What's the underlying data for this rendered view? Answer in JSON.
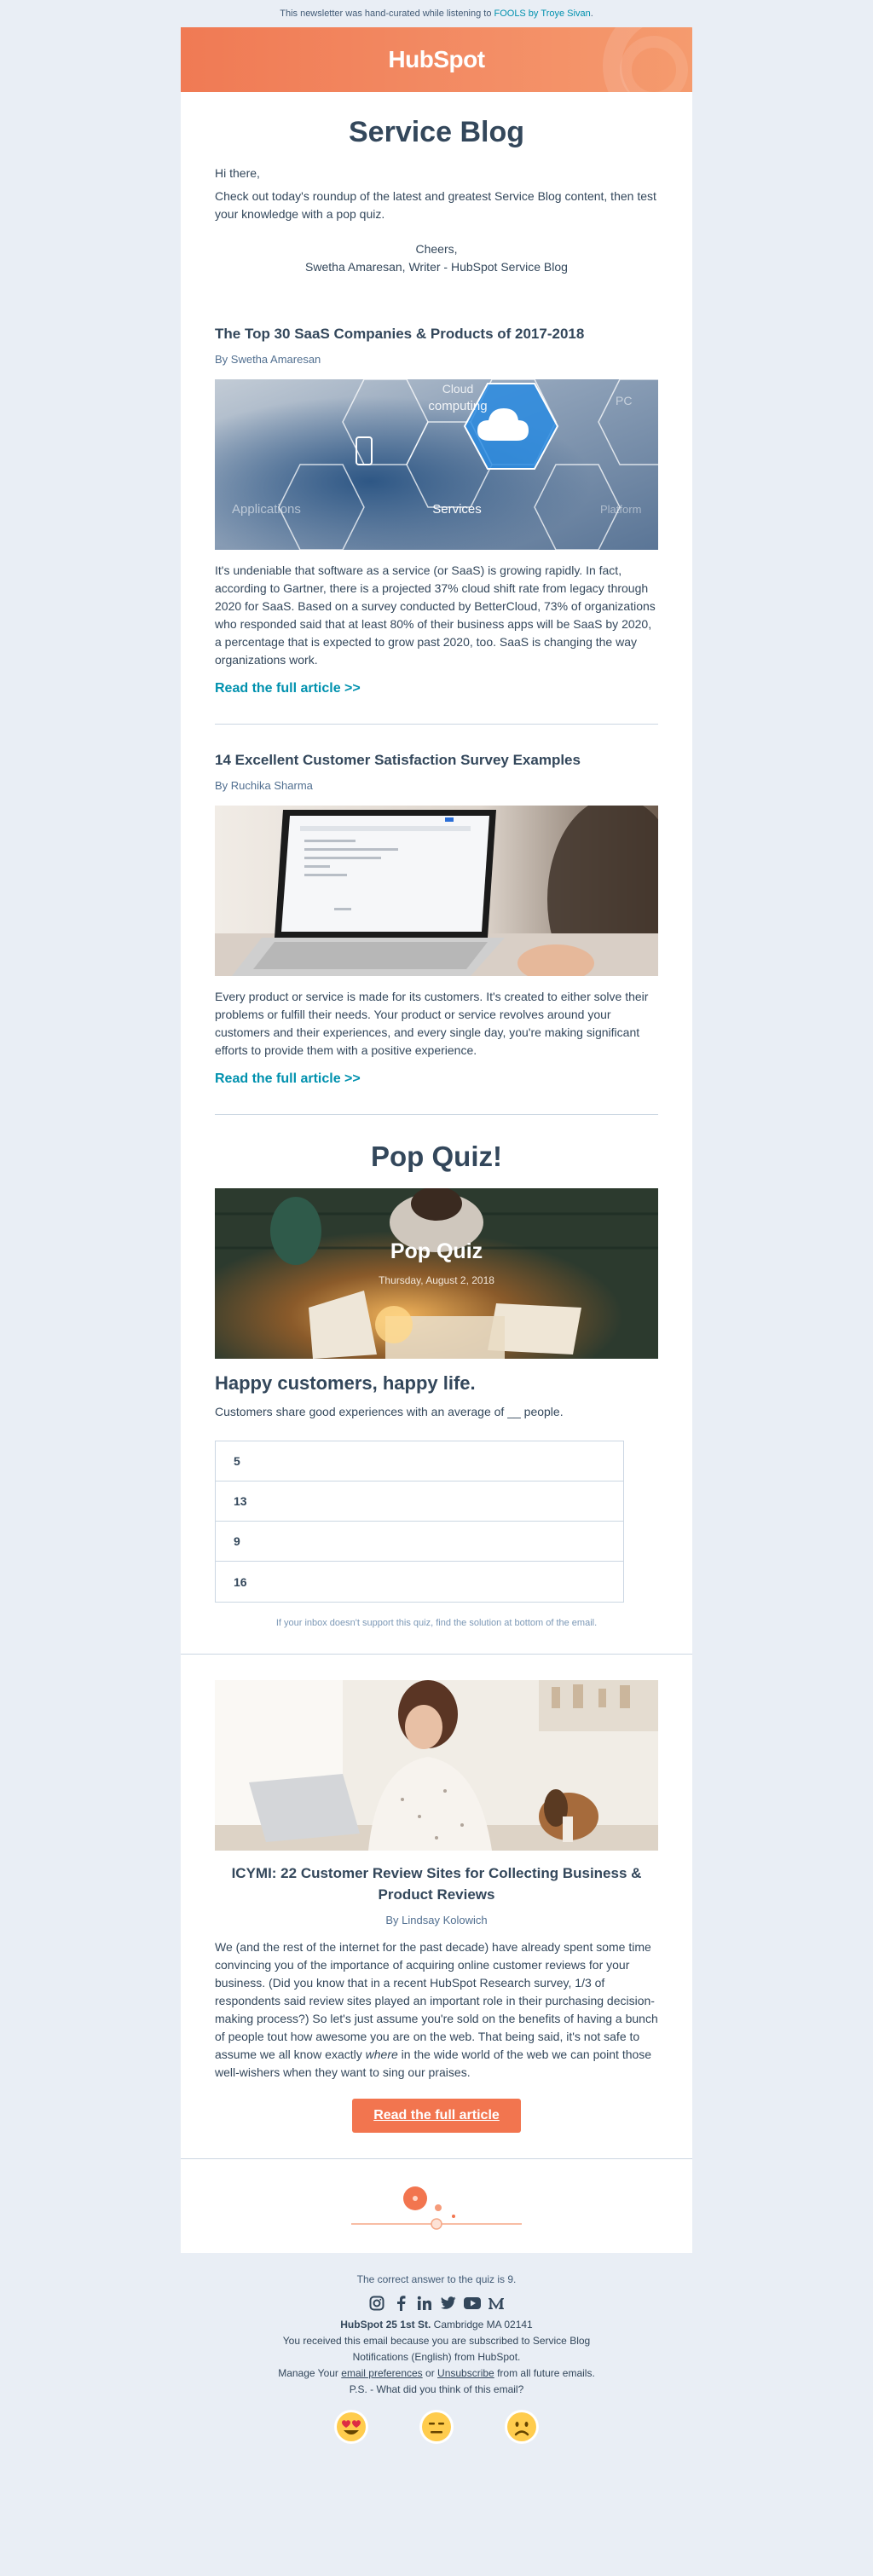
{
  "top_note": {
    "prefix": "This newsletter was hand-curated while listening to",
    "song": "FOOLS",
    "by": "by",
    "artist": "Troye Sivan",
    "suffix": "."
  },
  "header": {
    "logo": "HubSpot"
  },
  "intro": {
    "title": "Service Blog",
    "greeting": "Hi there,",
    "body": "Check out today's roundup of the latest and greatest Service Blog content, then test your knowledge with a pop quiz.",
    "signoff": "Cheers,",
    "signer": "Swetha Amaresan, Writer - HubSpot Service Blog"
  },
  "articles": [
    {
      "title": "The Top 30 SaaS Companies & Products of 2017-2018",
      "author": "By Swetha Amaresan",
      "image_labels": {
        "cloud": "Cloud",
        "computing": "computing",
        "services": "Services",
        "applications": "Applications",
        "pc": "PC",
        "tr": "Platform"
      },
      "body": "It's undeniable that software as a service (or SaaS) is growing rapidly. In fact, according to Gartner, there is a projected 37% cloud shift rate from legacy through 2020 for SaaS. Based on a survey conducted by BetterCloud, 73% of organizations who responded said that at least 80% of their business apps will be SaaS by 2020, a percentage that is expected to grow past 2020, too. SaaS is changing the way organizations work.",
      "link": "Read the full article >>"
    },
    {
      "title": "14 Excellent Customer Satisfaction Survey Examples",
      "author": "By Ruchika Sharma",
      "body": "Every product or service is made for its customers. It's created to either solve their problems or fulfill their needs. Your product or service revolves around your customers and their experiences, and every single day, you're making significant efforts to provide them with a positive experience.",
      "link": "Read the full article >>"
    }
  ],
  "quiz": {
    "title": "Pop Quiz!",
    "banner_title": "Pop Quiz",
    "banner_date": "Thursday, August 2, 2018",
    "question": "Happy customers, happy life.",
    "prompt": "Customers share good experiences with an average of __ people.",
    "options": [
      "5",
      "13",
      "9",
      "16"
    ],
    "note": "If your inbox doesn't support this quiz, find the solution at bottom of the email."
  },
  "icymi": {
    "title": "ICYMI: 22 Customer Review Sites for Collecting Business & Product Reviews",
    "author": "By Lindsay Kolowich",
    "body_before": "We (and the rest of the internet for the past decade) have already spent some time convincing you of the importance of acquiring online customer reviews for your business. (Did you know that in a recent HubSpot Research survey, 1/3 of respondents said review sites played an important role in their purchasing decision-making process?) So let's just assume you're sold on the benefits of having a bunch of people tout how awesome you are on the web. That being said, it's not safe to assume we all know exactly",
    "body_em": "where",
    "body_after": "in the wide world of the web we can point those well-wishers when they want to sing our praises.",
    "cta": "Read the full article"
  },
  "footer": {
    "answer": "The correct answer to the quiz is 9.",
    "company": "HubSpot",
    "street": "25 1st St.",
    "city": "Cambridge MA 02141",
    "received": "You received this email because you are subscribed to Service Blog Notifications (English) from HubSpot.",
    "manage_prefix": "Manage Your",
    "prefs_link": "email preferences",
    "or": "or",
    "unsub_link": "Unsubscribe",
    "manage_suffix": "from all future emails.",
    "ps": "P.S. - What did you think of this email?"
  },
  "colors": {
    "brand": "#f2754f",
    "link": "#0091ae",
    "text": "#33475b",
    "background": "#e9eef5"
  },
  "icons": {
    "social": [
      "instagram-icon",
      "facebook-icon",
      "linkedin-icon",
      "twitter-icon",
      "youtube-icon",
      "medium-icon"
    ],
    "emoji": [
      "love-emoji-icon",
      "neutral-emoji-icon",
      "sad-emoji-icon"
    ]
  }
}
